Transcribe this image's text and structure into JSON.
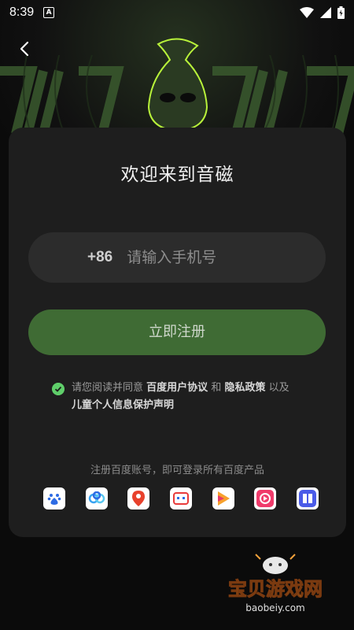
{
  "status_bar": {
    "time": "8:39",
    "notification_icon": "A"
  },
  "header": {
    "back_icon": "chevron-left-icon"
  },
  "card": {
    "title": "欢迎来到音磁",
    "phone": {
      "country_code": "+86",
      "placeholder": "请输入手机号"
    },
    "register_button": "立即注册",
    "agreement": {
      "checked": true,
      "prefix": "请您阅读并同意",
      "user_agreement": "百度用户协议",
      "and": "和",
      "privacy_policy": "隐私政策",
      "and2": "以及",
      "child_privacy": "儿童个人信息保护声明"
    },
    "baidu_note": "注册百度账号，即可登录所有百度产品",
    "apps": [
      {
        "name": "baidu-icon",
        "color": "#2d6be4"
      },
      {
        "name": "baidu-netdisk-icon",
        "color": "#38a3f2"
      },
      {
        "name": "baidu-map-icon",
        "color": "#e8412c"
      },
      {
        "name": "baidu-input-icon",
        "color": "#e83a3a"
      },
      {
        "name": "haokan-video-icon",
        "color": "#f7a12c"
      },
      {
        "name": "quanmin-video-icon",
        "color": "#f03b6b"
      },
      {
        "name": "tieba-icon",
        "color": "#4a5be8"
      }
    ]
  },
  "watermark": {
    "title": "宝贝游戏网",
    "url": "baobeiy.com"
  },
  "colors": {
    "accent_green": "#3f6b34",
    "check_green": "#5fce6a",
    "card_bg": "#1e1e1e"
  }
}
